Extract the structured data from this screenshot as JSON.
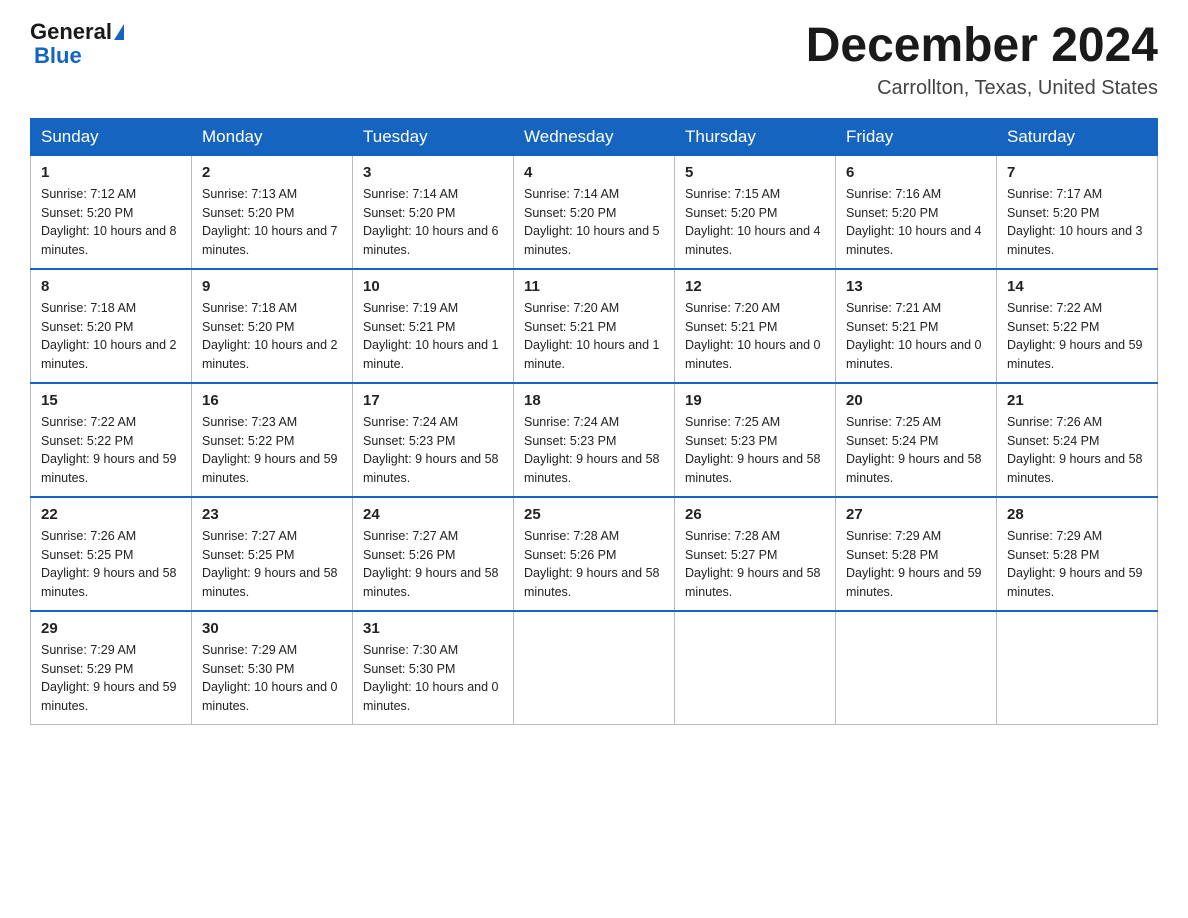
{
  "header": {
    "logo_general": "General",
    "logo_blue": "Blue",
    "month_title": "December 2024",
    "location": "Carrollton, Texas, United States"
  },
  "days_of_week": [
    "Sunday",
    "Monday",
    "Tuesday",
    "Wednesday",
    "Thursday",
    "Friday",
    "Saturday"
  ],
  "weeks": [
    [
      {
        "day": "1",
        "sunrise": "7:12 AM",
        "sunset": "5:20 PM",
        "daylight": "10 hours and 8 minutes."
      },
      {
        "day": "2",
        "sunrise": "7:13 AM",
        "sunset": "5:20 PM",
        "daylight": "10 hours and 7 minutes."
      },
      {
        "day": "3",
        "sunrise": "7:14 AM",
        "sunset": "5:20 PM",
        "daylight": "10 hours and 6 minutes."
      },
      {
        "day": "4",
        "sunrise": "7:14 AM",
        "sunset": "5:20 PM",
        "daylight": "10 hours and 5 minutes."
      },
      {
        "day": "5",
        "sunrise": "7:15 AM",
        "sunset": "5:20 PM",
        "daylight": "10 hours and 4 minutes."
      },
      {
        "day": "6",
        "sunrise": "7:16 AM",
        "sunset": "5:20 PM",
        "daylight": "10 hours and 4 minutes."
      },
      {
        "day": "7",
        "sunrise": "7:17 AM",
        "sunset": "5:20 PM",
        "daylight": "10 hours and 3 minutes."
      }
    ],
    [
      {
        "day": "8",
        "sunrise": "7:18 AM",
        "sunset": "5:20 PM",
        "daylight": "10 hours and 2 minutes."
      },
      {
        "day": "9",
        "sunrise": "7:18 AM",
        "sunset": "5:20 PM",
        "daylight": "10 hours and 2 minutes."
      },
      {
        "day": "10",
        "sunrise": "7:19 AM",
        "sunset": "5:21 PM",
        "daylight": "10 hours and 1 minute."
      },
      {
        "day": "11",
        "sunrise": "7:20 AM",
        "sunset": "5:21 PM",
        "daylight": "10 hours and 1 minute."
      },
      {
        "day": "12",
        "sunrise": "7:20 AM",
        "sunset": "5:21 PM",
        "daylight": "10 hours and 0 minutes."
      },
      {
        "day": "13",
        "sunrise": "7:21 AM",
        "sunset": "5:21 PM",
        "daylight": "10 hours and 0 minutes."
      },
      {
        "day": "14",
        "sunrise": "7:22 AM",
        "sunset": "5:22 PM",
        "daylight": "9 hours and 59 minutes."
      }
    ],
    [
      {
        "day": "15",
        "sunrise": "7:22 AM",
        "sunset": "5:22 PM",
        "daylight": "9 hours and 59 minutes."
      },
      {
        "day": "16",
        "sunrise": "7:23 AM",
        "sunset": "5:22 PM",
        "daylight": "9 hours and 59 minutes."
      },
      {
        "day": "17",
        "sunrise": "7:24 AM",
        "sunset": "5:23 PM",
        "daylight": "9 hours and 58 minutes."
      },
      {
        "day": "18",
        "sunrise": "7:24 AM",
        "sunset": "5:23 PM",
        "daylight": "9 hours and 58 minutes."
      },
      {
        "day": "19",
        "sunrise": "7:25 AM",
        "sunset": "5:23 PM",
        "daylight": "9 hours and 58 minutes."
      },
      {
        "day": "20",
        "sunrise": "7:25 AM",
        "sunset": "5:24 PM",
        "daylight": "9 hours and 58 minutes."
      },
      {
        "day": "21",
        "sunrise": "7:26 AM",
        "sunset": "5:24 PM",
        "daylight": "9 hours and 58 minutes."
      }
    ],
    [
      {
        "day": "22",
        "sunrise": "7:26 AM",
        "sunset": "5:25 PM",
        "daylight": "9 hours and 58 minutes."
      },
      {
        "day": "23",
        "sunrise": "7:27 AM",
        "sunset": "5:25 PM",
        "daylight": "9 hours and 58 minutes."
      },
      {
        "day": "24",
        "sunrise": "7:27 AM",
        "sunset": "5:26 PM",
        "daylight": "9 hours and 58 minutes."
      },
      {
        "day": "25",
        "sunrise": "7:28 AM",
        "sunset": "5:26 PM",
        "daylight": "9 hours and 58 minutes."
      },
      {
        "day": "26",
        "sunrise": "7:28 AM",
        "sunset": "5:27 PM",
        "daylight": "9 hours and 58 minutes."
      },
      {
        "day": "27",
        "sunrise": "7:29 AM",
        "sunset": "5:28 PM",
        "daylight": "9 hours and 59 minutes."
      },
      {
        "day": "28",
        "sunrise": "7:29 AM",
        "sunset": "5:28 PM",
        "daylight": "9 hours and 59 minutes."
      }
    ],
    [
      {
        "day": "29",
        "sunrise": "7:29 AM",
        "sunset": "5:29 PM",
        "daylight": "9 hours and 59 minutes."
      },
      {
        "day": "30",
        "sunrise": "7:29 AM",
        "sunset": "5:30 PM",
        "daylight": "10 hours and 0 minutes."
      },
      {
        "day": "31",
        "sunrise": "7:30 AM",
        "sunset": "5:30 PM",
        "daylight": "10 hours and 0 minutes."
      },
      null,
      null,
      null,
      null
    ]
  ]
}
